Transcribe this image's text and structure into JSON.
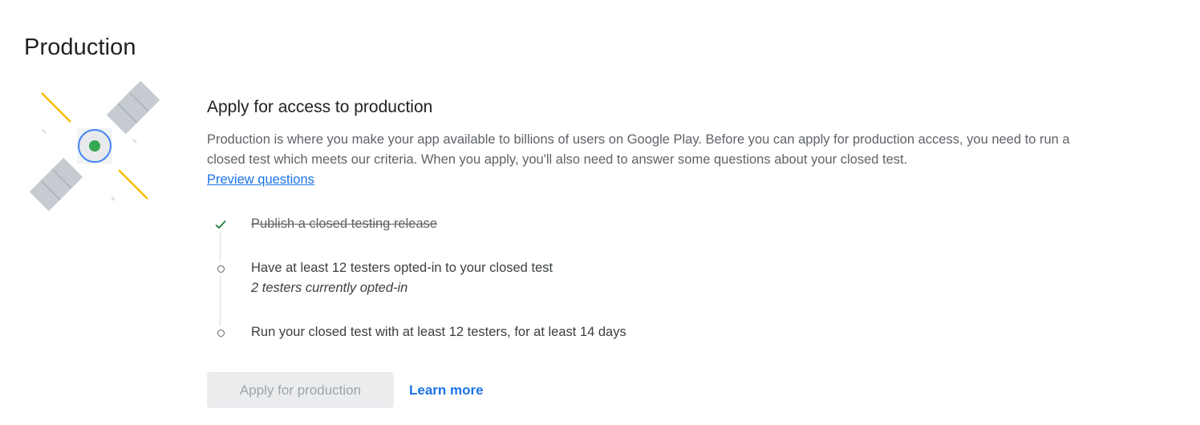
{
  "page": {
    "title": "Production"
  },
  "section": {
    "title": "Apply for access to production",
    "description": "Production is where you make your app available to billions of users on Google Play. Before you can apply for production access, you need to run a closed test which meets our criteria. When you apply, you'll also need to answer some questions about your closed test.",
    "preview_link": "Preview questions"
  },
  "illustration": {
    "icon": "satellite-icon",
    "accent_colors": {
      "panel": "#c5cbd1",
      "ray": "#fbbc04",
      "ring": "#4285f4",
      "dot": "#34a853"
    }
  },
  "steps": [
    {
      "label": "Publish a closed testing release",
      "status": "done",
      "icon": "check-icon"
    },
    {
      "label": "Have at least 12 testers opted-in to your closed test",
      "sublabel": "2 testers currently opted-in",
      "status": "pending",
      "icon": "circle-icon"
    },
    {
      "label": "Run your closed test with at least 12 testers, for at least 14 days",
      "status": "pending",
      "icon": "circle-icon"
    }
  ],
  "actions": {
    "apply_label": "Apply for production",
    "apply_disabled": true,
    "learn_more_label": "Learn more"
  },
  "colors": {
    "link": "#1a73e8",
    "check": "#188038",
    "disabled_button_bg": "#eaecee"
  }
}
